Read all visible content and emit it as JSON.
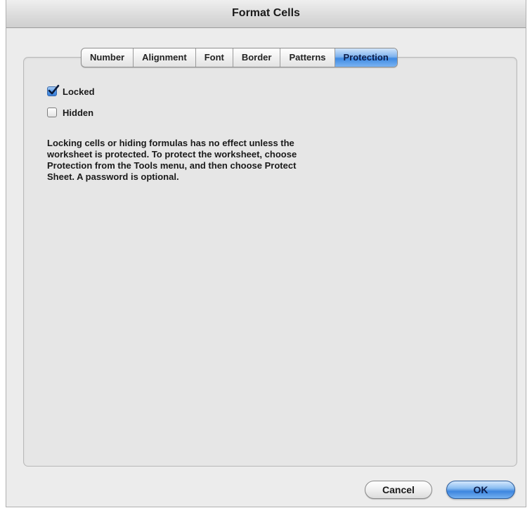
{
  "window": {
    "title": "Format Cells"
  },
  "tabs": [
    {
      "label": "Number",
      "active": false
    },
    {
      "label": "Alignment",
      "active": false
    },
    {
      "label": "Font",
      "active": false
    },
    {
      "label": "Border",
      "active": false
    },
    {
      "label": "Patterns",
      "active": false
    },
    {
      "label": "Protection",
      "active": true
    }
  ],
  "options": {
    "locked": {
      "label": "Locked",
      "checked": true
    },
    "hidden": {
      "label": "Hidden",
      "checked": false
    }
  },
  "info_text": "Locking cells or hiding formulas has no effect unless the\nworksheet is protected. To protect the worksheet, choose\nProtection from the Tools menu, and then choose Protect\nSheet. A password is optional.",
  "buttons": {
    "cancel_label": "Cancel",
    "ok_label": "OK"
  },
  "colors": {
    "accent": "#3f8ae2",
    "panel_bg": "#e6e6e6",
    "window_bg": "#ececec"
  }
}
